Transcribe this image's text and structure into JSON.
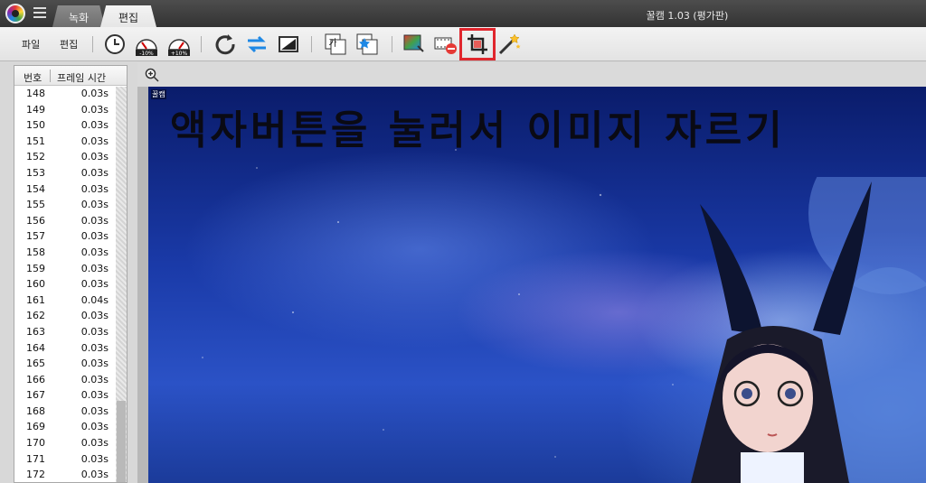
{
  "window": {
    "title": "꿀캠 1.03 (평가판)",
    "tabs": [
      {
        "label": "녹화",
        "active": false
      },
      {
        "label": "편집",
        "active": true
      }
    ]
  },
  "toolbar": {
    "file_label": "파일",
    "edit_label": "편집",
    "buttons": [
      {
        "icon": "clock-icon",
        "tooltip": ""
      },
      {
        "icon": "speed-minus-10-icon",
        "badge": "-10%"
      },
      {
        "icon": "speed-plus-10-icon",
        "badge": "+10%"
      },
      {
        "icon": "rotate-icon"
      },
      {
        "icon": "swap-frames-icon"
      },
      {
        "icon": "frame-effect-icon"
      },
      {
        "icon": "text-insert-icon",
        "glyph": "가"
      },
      {
        "icon": "image-insert-icon"
      },
      {
        "icon": "color-adjust-icon"
      },
      {
        "icon": "delete-frame-icon"
      },
      {
        "icon": "crop-icon",
        "highlighted": true
      },
      {
        "icon": "magic-wand-icon"
      }
    ],
    "highlight_color": "#e0262d"
  },
  "frame_table": {
    "headers": {
      "number": "번호",
      "frame_time": "프레임 시간"
    },
    "rows": [
      {
        "number": "148",
        "time": "0.03s"
      },
      {
        "number": "149",
        "time": "0.03s"
      },
      {
        "number": "150",
        "time": "0.03s"
      },
      {
        "number": "151",
        "time": "0.03s"
      },
      {
        "number": "152",
        "time": "0.03s"
      },
      {
        "number": "153",
        "time": "0.03s"
      },
      {
        "number": "154",
        "time": "0.03s"
      },
      {
        "number": "155",
        "time": "0.03s"
      },
      {
        "number": "156",
        "time": "0.03s"
      },
      {
        "number": "157",
        "time": "0.03s"
      },
      {
        "number": "158",
        "time": "0.03s"
      },
      {
        "number": "159",
        "time": "0.03s"
      },
      {
        "number": "160",
        "time": "0.03s"
      },
      {
        "number": "161",
        "time": "0.04s"
      },
      {
        "number": "162",
        "time": "0.03s"
      },
      {
        "number": "163",
        "time": "0.03s"
      },
      {
        "number": "164",
        "time": "0.03s"
      },
      {
        "number": "165",
        "time": "0.03s"
      },
      {
        "number": "166",
        "time": "0.03s"
      },
      {
        "number": "167",
        "time": "0.03s"
      },
      {
        "number": "168",
        "time": "0.03s"
      },
      {
        "number": "169",
        "time": "0.03s"
      },
      {
        "number": "170",
        "time": "0.03s"
      },
      {
        "number": "171",
        "time": "0.03s"
      },
      {
        "number": "172",
        "time": "0.03s"
      }
    ]
  },
  "viewer": {
    "zoom_icon": "zoom-in-icon",
    "watermark": "꿀캠",
    "overlay_text": "액자버튼을 눌러서 이미지 자르기"
  }
}
